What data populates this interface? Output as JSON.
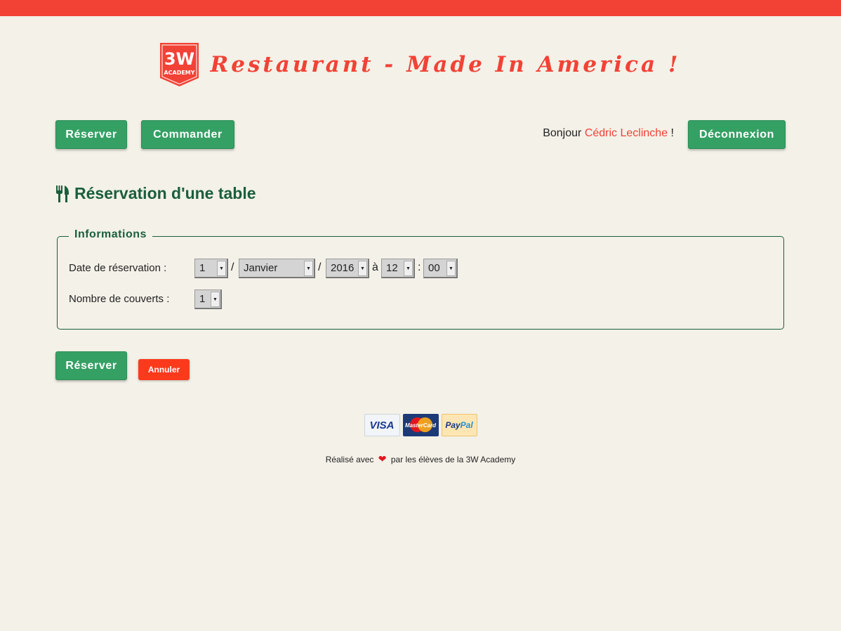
{
  "colors": {
    "brand_red": "#f24236",
    "green": "#35a064",
    "dark_green": "#1b5e3b",
    "cancel_red": "#fb3a1c"
  },
  "header": {
    "logo_top": "3W",
    "logo_bottom": "ACADEMY",
    "title": "Restaurant - Made In America !"
  },
  "nav": {
    "reserve_label": "Réserver",
    "order_label": "Commander",
    "logout_label": "Déconnexion"
  },
  "greeting": {
    "prefix": "Bonjour",
    "user": "Cédric Leclinche",
    "suffix": "!"
  },
  "page": {
    "icon": "fork-knife-icon",
    "title": "Réservation d'une table"
  },
  "form": {
    "legend": "Informations",
    "date_label": "Date de réservation :",
    "day": "1",
    "month": "Janvier",
    "year": "2016",
    "sep_slash": "/",
    "sep_at": "à",
    "hour": "12",
    "sep_colon": ":",
    "minute": "00",
    "covers_label": "Nombre de couverts :",
    "covers": "1",
    "submit_label": "Réserver",
    "cancel_label": "Annuler"
  },
  "payments": {
    "visa": "VISA",
    "mastercard": "MasterCard",
    "paypal_a": "Pay",
    "paypal_b": "Pal"
  },
  "footer": {
    "before": "Réalisé avec",
    "after": "par les élèves de la 3W Academy"
  }
}
